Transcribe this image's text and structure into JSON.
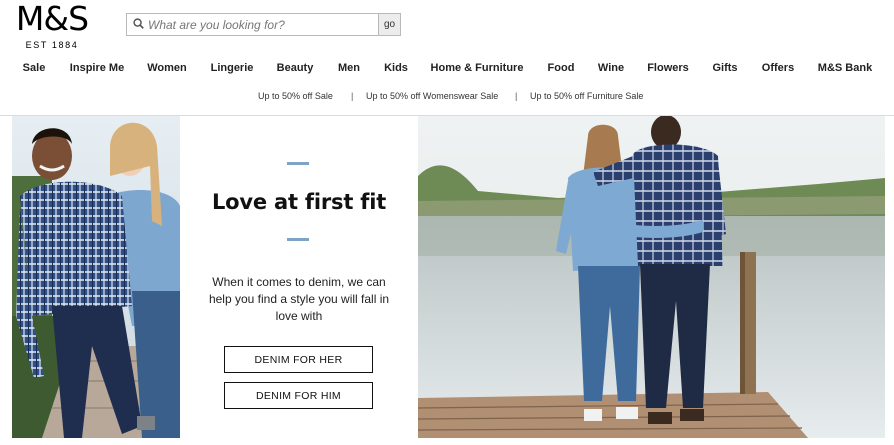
{
  "brand": {
    "name": "M&S",
    "tagline": "EST 1884"
  },
  "search": {
    "placeholder": "What are you looking for?",
    "button_label": "go",
    "icon": "search-icon"
  },
  "nav": {
    "items": [
      {
        "label": "Sale"
      },
      {
        "label": "Inspire Me"
      },
      {
        "label": "Women"
      },
      {
        "label": "Lingerie"
      },
      {
        "label": "Beauty"
      },
      {
        "label": "Men"
      },
      {
        "label": "Kids"
      },
      {
        "label": "Home & Furniture"
      },
      {
        "label": "Food"
      },
      {
        "label": "Wine"
      },
      {
        "label": "Flowers"
      },
      {
        "label": "Gifts"
      },
      {
        "label": "Offers"
      },
      {
        "label": "M&S Bank"
      }
    ]
  },
  "promos": [
    {
      "label": "Up to 50% off Sale"
    },
    {
      "label": "Up to 50% off Womenswear Sale"
    },
    {
      "label": "Up to 50% off Furniture Sale"
    }
  ],
  "promo_separator": "|",
  "hero": {
    "headline": "Love at first fit",
    "body": "When it comes to denim, we can help you find a style you will fall in love with",
    "cta_her": "DENIM FOR HER",
    "cta_him": "DENIM FOR HIM",
    "accent_color": "#7ea3c4"
  }
}
